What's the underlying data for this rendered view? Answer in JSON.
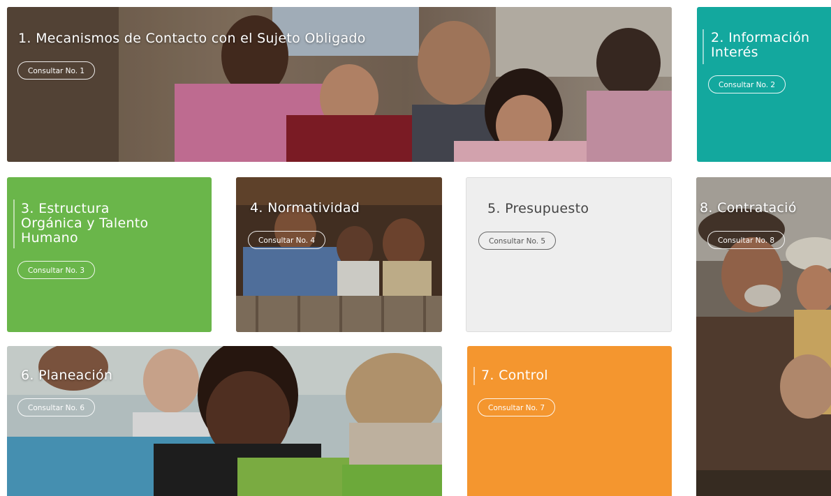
{
  "colors": {
    "teal": "#13a89e",
    "green": "#6ab64a",
    "light_gray": "#eeeeee",
    "orange": "#f4962f",
    "white": "#ffffff",
    "dark_text": "#444444"
  },
  "tiles": [
    {
      "title": "1. Mecanismos de Contacto con el Sujeto Obligado",
      "button": "Consultar No. 1"
    },
    {
      "title": "2. Información\nInterés",
      "button": "Consultar No. 2"
    },
    {
      "title": "3. Estructura\nOrgánica y Talento\nHumano",
      "button": "Consultar No. 3"
    },
    {
      "title": "4. Normatividad",
      "button": "Consultar No. 4"
    },
    {
      "title": "5. Presupuesto",
      "button": "Consultar No. 5"
    },
    {
      "title": "6. Planeación",
      "button": "Consultar No. 6"
    },
    {
      "title": "7. Control",
      "button": "Consultar No. 7"
    },
    {
      "title": "8. Contratació",
      "button": "Consultar No. 8"
    }
  ],
  "icons": {
    "photo_family": "family-photo",
    "photo_children_window": "children-window-photo",
    "photo_classroom": "classroom-photo",
    "photo_elderly": "elderly-man-photo"
  }
}
